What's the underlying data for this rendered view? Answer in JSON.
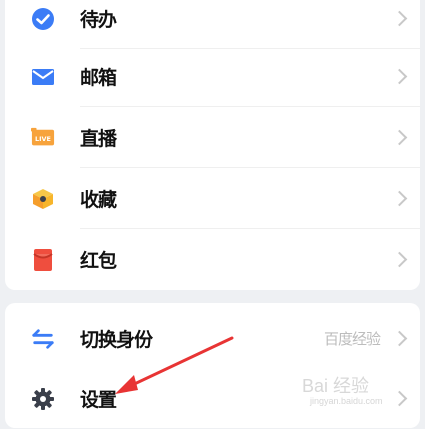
{
  "menu_group_1": [
    {
      "label": "待办",
      "icon": "check-circle-icon",
      "color": "#3b7cf6"
    },
    {
      "label": "邮箱",
      "icon": "mail-icon",
      "color": "#3b7cf6"
    },
    {
      "label": "直播",
      "icon": "live-icon",
      "icon_text": "LIVE",
      "color": "#f7a33c"
    },
    {
      "label": "收藏",
      "icon": "cube-icon",
      "color": "#f7b52b"
    },
    {
      "label": "红包",
      "icon": "red-envelope-icon",
      "color": "#ef4e3e"
    }
  ],
  "menu_group_2": [
    {
      "label": "切换身份",
      "icon": "swap-arrows-icon",
      "color": "#3b7cf6",
      "extra": "百度经验"
    },
    {
      "label": "设置",
      "icon": "gear-icon",
      "color": "#3a3f4a"
    }
  ],
  "overlay": {
    "annotation_arrow_color": "#e83434",
    "watermark_text": "Bai 经验",
    "watermark_sub": "jingyan.baidu.com"
  }
}
